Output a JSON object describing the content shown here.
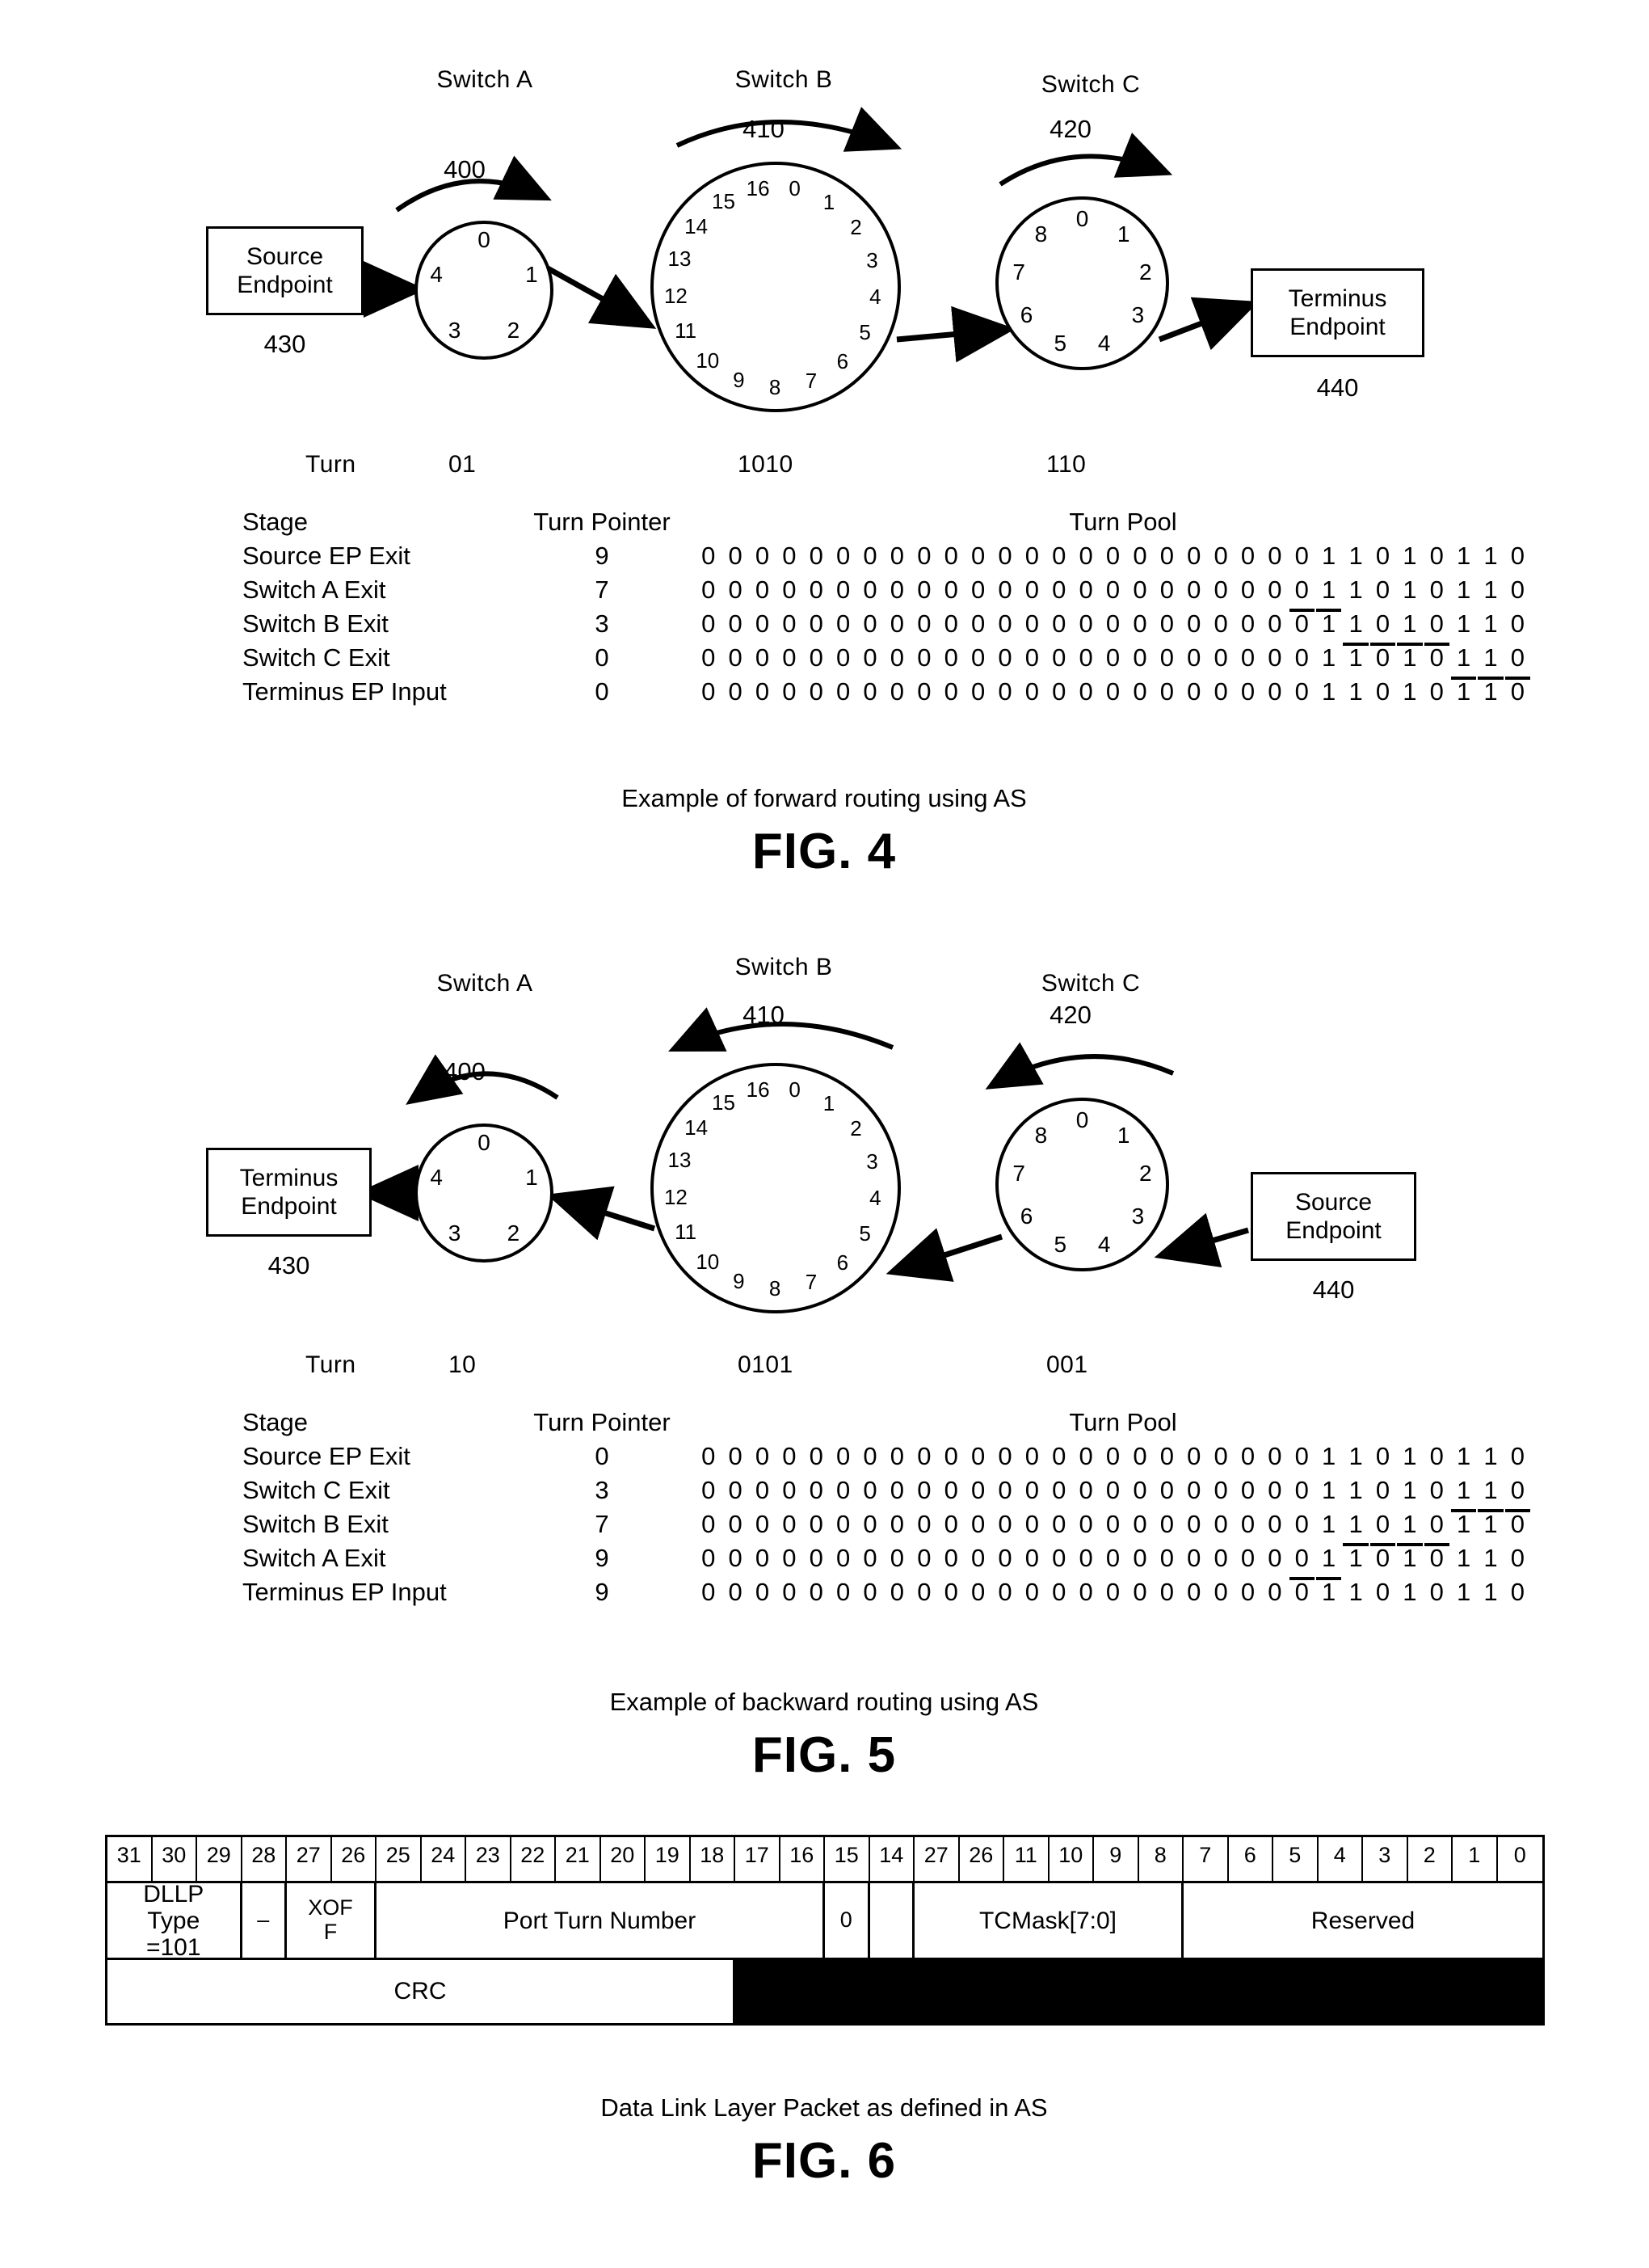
{
  "figures": [
    {
      "id": "fig4",
      "caption": "Example of forward routing using AS",
      "figure_label": "FIG. 4",
      "switches": [
        {
          "name": "Switch A",
          "ref": "400",
          "ports": [
            "0",
            "1",
            "2",
            "3",
            "4"
          ],
          "turn": "01"
        },
        {
          "name": "Switch B",
          "ref": "410",
          "ports": [
            "0",
            "1",
            "2",
            "3",
            "4",
            "5",
            "6",
            "7",
            "8",
            "9",
            "10",
            "11",
            "12",
            "13",
            "14",
            "15",
            "16"
          ],
          "turn": "1010"
        },
        {
          "name": "Switch C",
          "ref": "420",
          "ports": [
            "0",
            "1",
            "2",
            "3",
            "4",
            "5",
            "6",
            "7",
            "8"
          ],
          "turn": "110"
        }
      ],
      "left_endpoint": {
        "line1": "Source",
        "line2": "Endpoint",
        "ref": "430"
      },
      "right_endpoint": {
        "line1": "Terminus",
        "line2": "Endpoint",
        "ref": "440"
      },
      "turn_row_label": "Turn",
      "headers": {
        "stage": "Stage",
        "pointer": "Turn Pointer",
        "pool": "Turn Pool"
      },
      "rows": [
        {
          "stage": "Source EP Exit",
          "pointer": "9",
          "pool": "0000000000000000000000011010110",
          "underline_start": -1,
          "underline_len": 0
        },
        {
          "stage": "Switch A Exit",
          "pointer": "7",
          "pool": "0000000000000000000000011010110",
          "underline_start": 22,
          "underline_len": 2
        },
        {
          "stage": "Switch B Exit",
          "pointer": "3",
          "pool": "0000000000000000000000011010110",
          "underline_start": 24,
          "underline_len": 4
        },
        {
          "stage": "Switch C Exit",
          "pointer": "0",
          "pool": "0000000000000000000000011010110",
          "underline_start": 28,
          "underline_len": 3
        },
        {
          "stage": "Terminus EP Input",
          "pointer": "0",
          "pool": "0000000000000000000000011010110",
          "underline_start": -1,
          "underline_len": 0
        }
      ]
    },
    {
      "id": "fig5",
      "caption": "Example of backward routing using AS",
      "figure_label": "FIG. 5",
      "switches": [
        {
          "name": "Switch A",
          "ref": "400",
          "ports": [
            "0",
            "1",
            "2",
            "3",
            "4"
          ],
          "turn": "10"
        },
        {
          "name": "Switch B",
          "ref": "410",
          "ports": [
            "0",
            "1",
            "2",
            "3",
            "4",
            "5",
            "6",
            "7",
            "8",
            "9",
            "10",
            "11",
            "12",
            "13",
            "14",
            "15",
            "16"
          ],
          "turn": "0101"
        },
        {
          "name": "Switch C",
          "ref": "420",
          "ports": [
            "0",
            "1",
            "2",
            "3",
            "4",
            "5",
            "6",
            "7",
            "8"
          ],
          "turn": "001"
        }
      ],
      "left_endpoint": {
        "line1": "Terminus",
        "line2": "Endpoint",
        "ref": "430"
      },
      "right_endpoint": {
        "line1": "Source",
        "line2": "Endpoint",
        "ref": "440"
      },
      "turn_row_label": "Turn",
      "headers": {
        "stage": "Stage",
        "pointer": "Turn Pointer",
        "pool": "Turn Pool"
      },
      "rows": [
        {
          "stage": "Source EP Exit",
          "pointer": "0",
          "pool": "0000000000000000000000011010110",
          "underline_start": -1,
          "underline_len": 0
        },
        {
          "stage": "Switch C Exit",
          "pointer": "3",
          "pool": "0000000000000000000000011010110",
          "underline_start": 28,
          "underline_len": 3
        },
        {
          "stage": "Switch B Exit",
          "pointer": "7",
          "pool": "0000000000000000000000011010110",
          "underline_start": 24,
          "underline_len": 4
        },
        {
          "stage": "Switch A Exit",
          "pointer": "9",
          "pool": "0000000000000000000000011010110",
          "underline_start": 22,
          "underline_len": 2
        },
        {
          "stage": "Terminus EP Input",
          "pointer": "9",
          "pool": "0000000000000000000000011010110",
          "underline_start": -1,
          "underline_len": 0
        }
      ]
    }
  ],
  "fig6": {
    "caption": "Data Link Layer Packet as defined in AS",
    "figure_label": "FIG. 6",
    "bit_labels": [
      "31",
      "30",
      "29",
      "28",
      "27",
      "26",
      "25",
      "24",
      "23",
      "22",
      "21",
      "20",
      "19",
      "18",
      "17",
      "16",
      "15",
      "14",
      "27",
      "26",
      "11",
      "10",
      "9",
      "8",
      "7",
      "6",
      "5",
      "4",
      "3",
      "2",
      "1",
      "0"
    ],
    "fields": [
      {
        "label": "DLLP\nType\n=101",
        "span": 3
      },
      {
        "label": "–",
        "span": 1
      },
      {
        "label": "XOF\nF",
        "span": 2
      },
      {
        "label": "Port Turn Number",
        "span": 10
      },
      {
        "label": "0",
        "span": 1
      },
      {
        "label": "",
        "span": 1
      },
      {
        "label": "TCMask[7:0]",
        "span": 6
      },
      {
        "label": "Reserved",
        "span": 8
      }
    ],
    "crc_label": "CRC",
    "crc_span": 14
  }
}
